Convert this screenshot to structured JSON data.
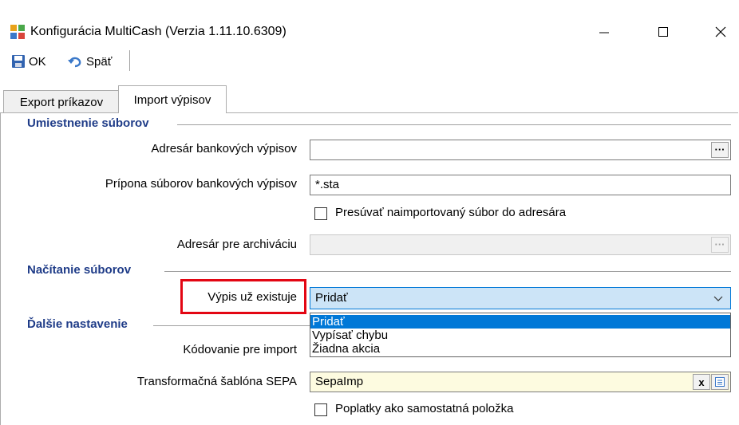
{
  "window": {
    "title": "Konfigurácia MultiCash (Verzia 1.11.10.6309)",
    "minimize_icon": "minimize-icon",
    "maximize_icon": "maximize-icon",
    "close_icon": "close-icon"
  },
  "toolbar": {
    "ok_label": "OK",
    "back_label": "Späť"
  },
  "tabs": [
    {
      "label": "Export príkazov",
      "active": false
    },
    {
      "label": "Import výpisov",
      "active": true
    }
  ],
  "sections": {
    "file_location": "Umiestnenie súborov",
    "file_loading": "Načítanie súborov",
    "other_settings": "Ďalšie nastavenie"
  },
  "fields": {
    "statement_dir_label": "Adresár bankových výpisov",
    "statement_dir_value": "",
    "extension_label": "Prípona súborov bankových výpisov",
    "extension_value": "*.sta",
    "move_file_label": "Presúvať naimportovaný súbor do adresára",
    "move_file_checked": false,
    "archive_dir_label": "Adresár pre archiváciu",
    "archive_dir_value": "",
    "exists_label": "Výpis už existuje",
    "exists_value": "Pridať",
    "encoding_label": "Kódovanie pre import",
    "sepa_label": "Transformačná šablóna SEPA",
    "sepa_value": "SepaImp",
    "fees_label": "Poplatky ako samostatná položka",
    "fees_checked": false,
    "browse_symbol": "···",
    "clear_symbol": "x"
  },
  "dropdown": {
    "options": [
      "Pridať",
      "Vypísať chybu",
      "Žiadna akcia"
    ],
    "selected_index": 0
  },
  "colors": {
    "highlight": "#e30613",
    "section_title": "#1f3c88",
    "selection": "#0078d7"
  }
}
